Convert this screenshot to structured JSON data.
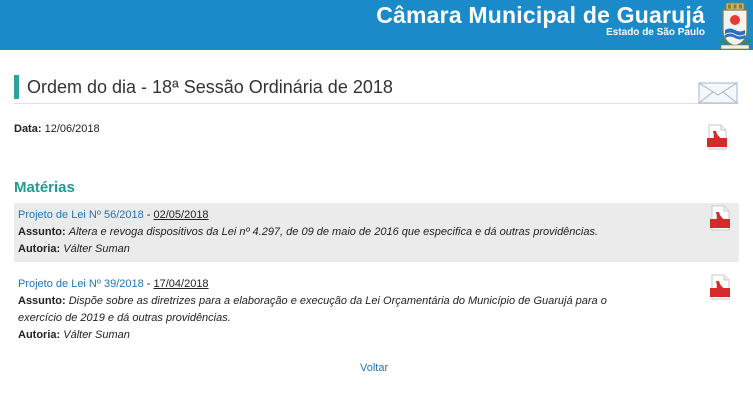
{
  "header": {
    "title": "Câmara Municipal de Guarujá",
    "subtitle": "Estado de São Paulo",
    "bar_color": "#1a8ac8",
    "crest_icon": "city-crest-icon"
  },
  "page": {
    "title": "Ordem do dia - 18ª Sessão Ordinária de 2018",
    "accent_color": "#2aa39a",
    "mail_icon": "envelope-icon",
    "data_label": "Data:",
    "data_value": "12/06/2018",
    "pdf_icon": "pdf-icon"
  },
  "materias": {
    "heading": "Matérias",
    "heading_color": "#229a92",
    "items": [
      {
        "project": "Projeto de Lei Nº 56/2018",
        "sep": " - ",
        "date": "02/05/2018",
        "assunto_label": "Assunto:",
        "assunto_lines": [
          "Altera e revoga dispositivos da Lei nº 4.297, de 09 de maio de 2016 que especifica e dá outras providências."
        ],
        "autoria_label": "Autoria:",
        "autoria": "Válter Suman"
      },
      {
        "project": "Projeto de Lei Nº 39/2018",
        "sep": " - ",
        "date": "17/04/2018",
        "assunto_label": "Assunto:",
        "assunto_lines": [
          "Dispõe sobre as diretrizes para a elaboração e execução da Lei Orçamentária do Município de Guarujá para o",
          "exercício de 2019 e dá outras providências."
        ],
        "autoria_label": "Autoria:",
        "autoria": "Válter Suman"
      }
    ]
  },
  "footer": {
    "back_label": "Voltar",
    "link_color": "#2076b5"
  }
}
